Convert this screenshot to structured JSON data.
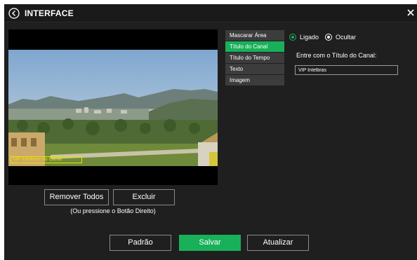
{
  "header": {
    "title": "INTERFACE",
    "back_icon": "back-arrow-circle-icon",
    "close_icon": "close-icon"
  },
  "preview": {
    "osd_text": "VIP Intelbras do Canal",
    "osd_color": "#f0e000"
  },
  "preview_actions": {
    "remove_all_label": "Remover Todos",
    "delete_label": "Excluir",
    "hint": "(Ou pressione o Botão Direito)"
  },
  "menu": {
    "items": [
      {
        "label": "Mascarar Área",
        "active": false
      },
      {
        "label": "Título do Canal",
        "active": true
      },
      {
        "label": "Título do Tempo",
        "active": false
      },
      {
        "label": "Texto",
        "active": false
      },
      {
        "label": "Imagem",
        "active": false
      }
    ]
  },
  "options": {
    "radio_on_label": "Ligado",
    "radio_off_label": "Ocultar",
    "field_label": "Entre com o Título do Canal:",
    "field_value": "VIP Intelbras"
  },
  "footer": {
    "default_label": "Padrão",
    "save_label": "Salvar",
    "refresh_label": "Atualizar"
  },
  "colors": {
    "accent": "#19b05a",
    "background": "#1f1f1f",
    "menu_bg": "#3c3c3c"
  }
}
